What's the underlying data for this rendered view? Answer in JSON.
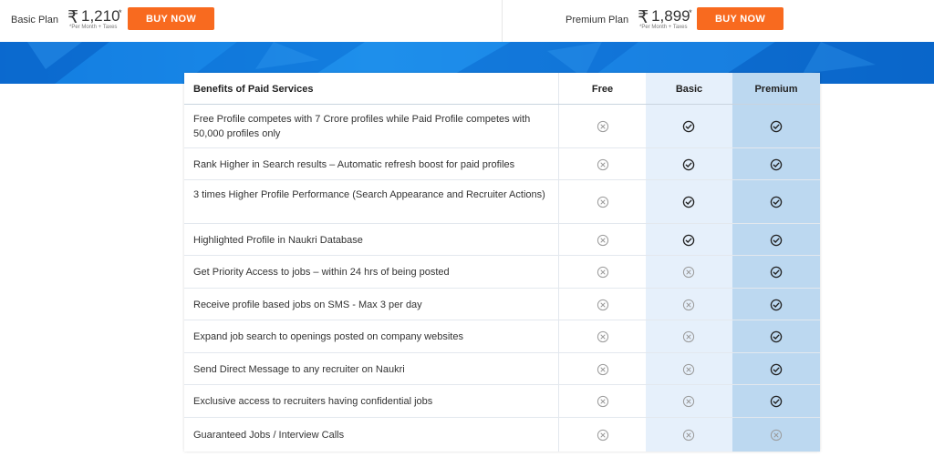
{
  "plans": [
    {
      "name": "Basic Plan",
      "currency": "₹",
      "price": "1,210",
      "star": "*",
      "note": "*Per Month + Taxes",
      "button": "BUY NOW"
    },
    {
      "name": "Premium Plan",
      "currency": "₹",
      "price": "1,899",
      "star": "*",
      "note": "*Per Month + Taxes",
      "button": "BUY NOW"
    }
  ],
  "colors": {
    "accent": "#f86a1f",
    "banner": "#1479dd",
    "basic_col": "#e6f0fb",
    "premium_col": "#bcd8f0",
    "check": "#222222",
    "cross": "#9a9a9a"
  },
  "table": {
    "headers": {
      "benefit": "Benefits of Paid Services",
      "free": "Free",
      "basic": "Basic",
      "premium": "Premium"
    },
    "rows": [
      {
        "text": "Free Profile competes with 7 Crore profiles while Paid Profile competes with 50,000 profiles only",
        "free": false,
        "basic": true,
        "premium": true
      },
      {
        "text": "Rank Higher in Search results – Automatic refresh boost for paid profiles",
        "free": false,
        "basic": true,
        "premium": true
      },
      {
        "text": "3 times Higher Profile Performance (Search Appearance and Recruiter Actions)",
        "free": false,
        "basic": true,
        "premium": true
      },
      {
        "text": "Highlighted Profile in Naukri Database",
        "free": false,
        "basic": true,
        "premium": true
      },
      {
        "text": "Get Priority Access to jobs – within 24 hrs of being posted",
        "free": false,
        "basic": false,
        "premium": true
      },
      {
        "text": "Receive profile based jobs on SMS - Max 3 per day",
        "free": false,
        "basic": false,
        "premium": true
      },
      {
        "text": "Expand job search to openings posted on company websites",
        "free": false,
        "basic": false,
        "premium": true
      },
      {
        "text": "Send Direct Message to any recruiter on Naukri",
        "free": false,
        "basic": false,
        "premium": true
      },
      {
        "text": "Exclusive access to recruiters having confidential jobs",
        "free": false,
        "basic": false,
        "premium": true
      },
      {
        "text": "Guaranteed Jobs / Interview Calls",
        "free": false,
        "basic": false,
        "premium": false
      }
    ]
  }
}
